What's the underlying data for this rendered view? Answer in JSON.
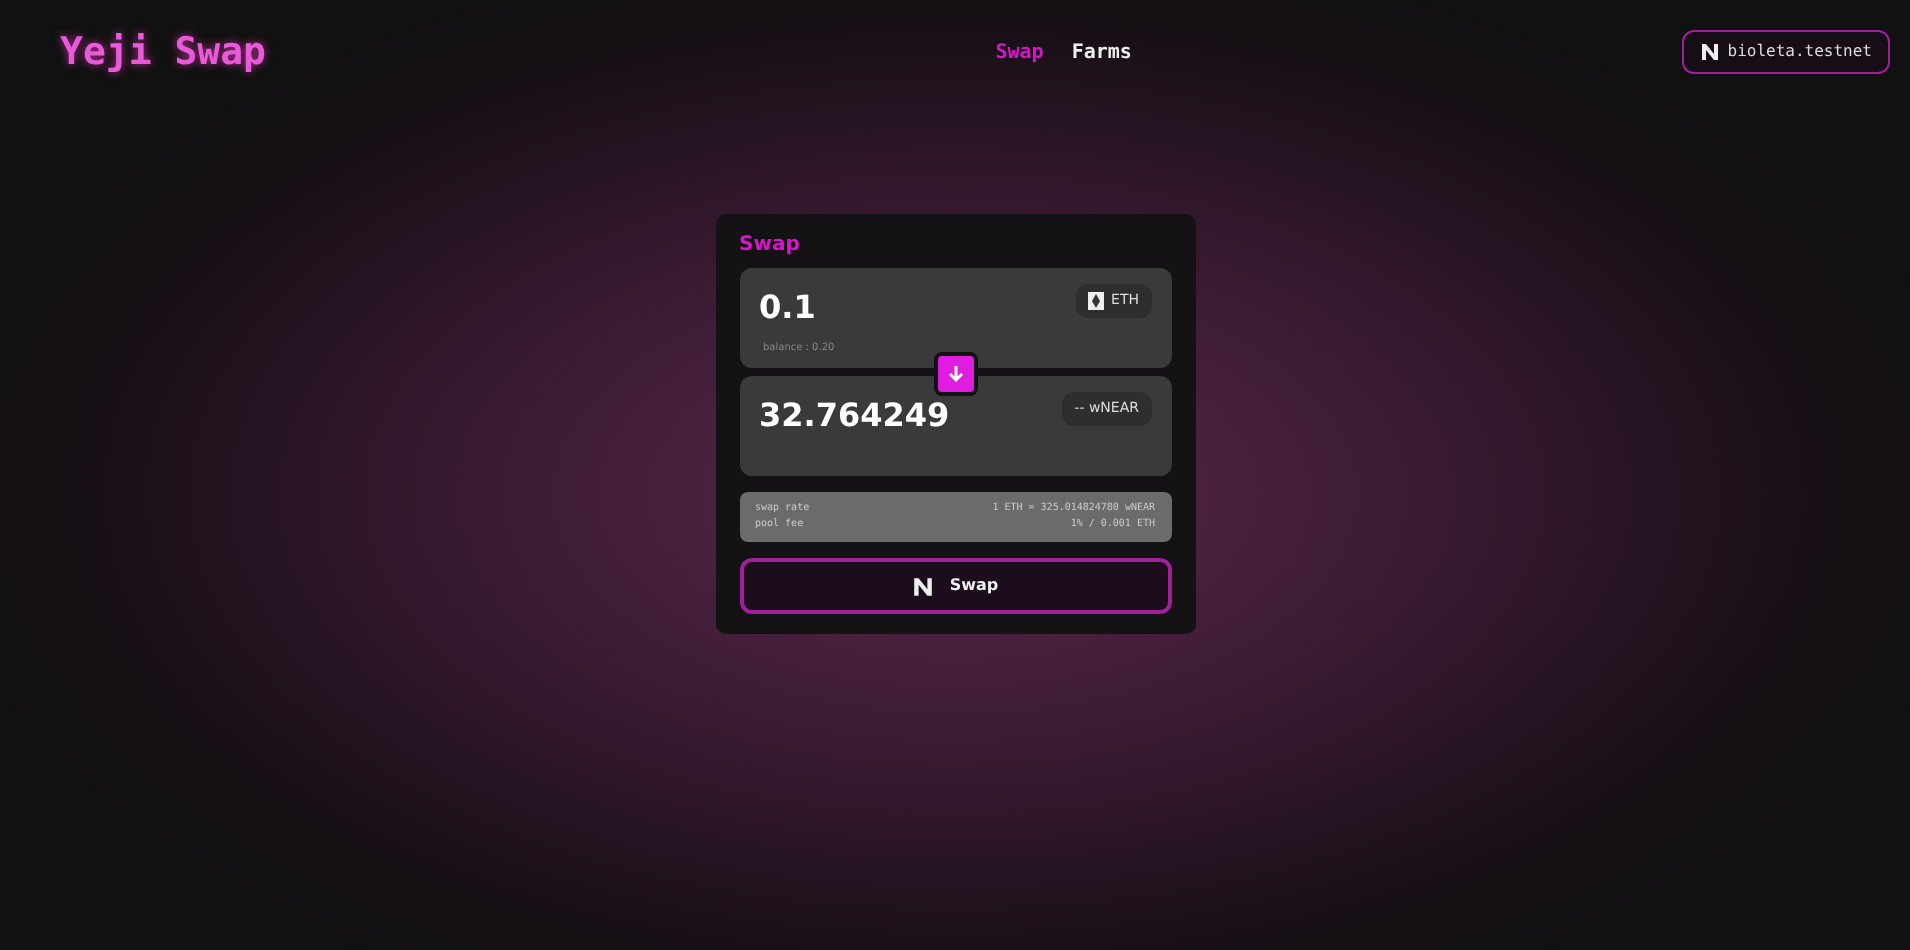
{
  "brand": "Yeji Swap",
  "nav": [
    {
      "label": "Swap",
      "selected": true
    },
    {
      "label": "Farms",
      "selected": false
    }
  ],
  "account": {
    "label": "bioleta.testnet"
  },
  "swap": {
    "title": "Swap",
    "from": {
      "amount": "0.1",
      "token": "ETH",
      "balance": "balance : 0.20"
    },
    "to": {
      "amount": "32.764249",
      "token": "-- wNEAR"
    },
    "details": [
      {
        "label": "swap rate",
        "value": "1 ETH = 325.014824780 wNEAR"
      },
      {
        "label": "pool fee",
        "value": "1% / 0.001 ETH"
      }
    ],
    "button": "Swap"
  }
}
